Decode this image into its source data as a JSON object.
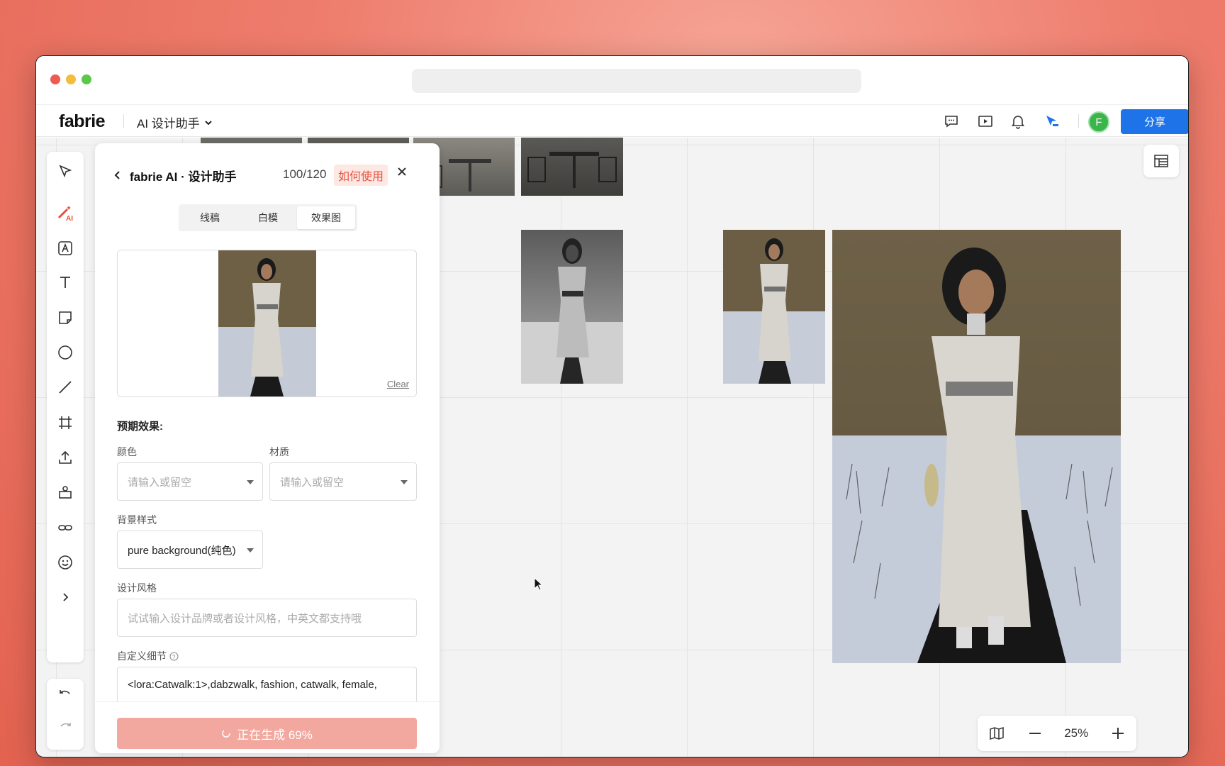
{
  "app": {
    "logo": "fabrie",
    "assistant_menu": "AI 设计助手",
    "share_label": "分享",
    "avatar_initial": "F",
    "accent": "#1e73e8"
  },
  "panel": {
    "title": "fabrie AI · 设计助手",
    "credits": "100/120",
    "howto": "如何使用",
    "tabs": [
      {
        "label": "线稿",
        "active": false
      },
      {
        "label": "白模",
        "active": false
      },
      {
        "label": "效果图",
        "active": true
      }
    ],
    "clear_label": "Clear",
    "expected_label": "预期效果:",
    "color_label": "颜色",
    "color_placeholder": "请输入或留空",
    "material_label": "材质",
    "material_placeholder": "请输入或留空",
    "bg_label": "背景样式",
    "bg_value": "pure background(纯色)",
    "style_label": "设计风格",
    "style_placeholder": "试试输入设计品牌或者设计风格，中英文都支持哦",
    "custom_label": "自定义细节",
    "custom_value": "<lora:Catwalk:1>,dabzwalk, fashion, catwalk, female,",
    "generate_label": "正在生成 69%",
    "progress": 0.69
  },
  "zoom": {
    "level": "25%"
  }
}
